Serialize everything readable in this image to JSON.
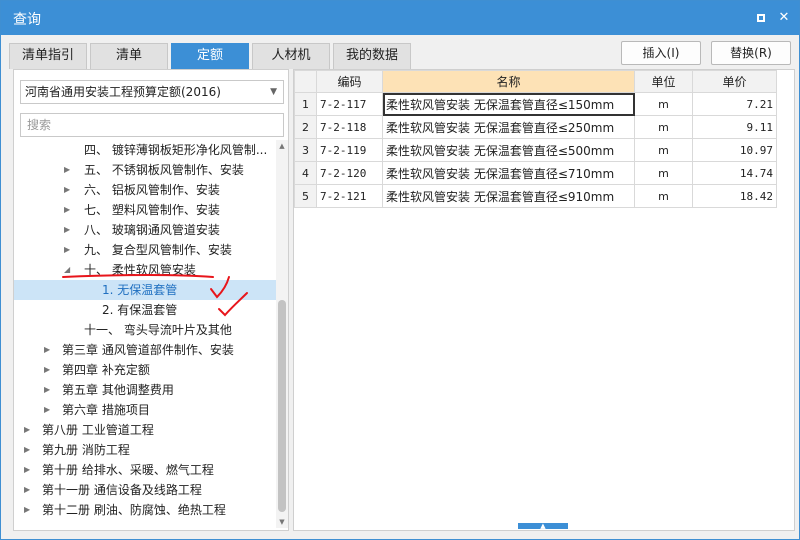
{
  "window": {
    "title": "查询"
  },
  "tabs": [
    {
      "label": "清单指引",
      "active": false
    },
    {
      "label": "清单",
      "active": false
    },
    {
      "label": "定额",
      "active": true
    },
    {
      "label": "人材机",
      "active": false
    },
    {
      "label": "我的数据",
      "active": false
    }
  ],
  "actions": {
    "insert_label": "插入(I)",
    "replace_label": "替换(R)"
  },
  "library": {
    "selected": "河南省通用安装工程预算定额(2016)"
  },
  "search": {
    "placeholder": "搜索"
  },
  "tree": [
    {
      "label": "四、 镀锌薄钢板矩形净化风管制...",
      "level": 3,
      "expanded": null,
      "selected": false
    },
    {
      "label": "五、 不锈钢板风管制作、安装",
      "level": 3,
      "expanded": false,
      "selected": false
    },
    {
      "label": "六、 铝板风管制作、安装",
      "level": 3,
      "expanded": false,
      "selected": false
    },
    {
      "label": "七、 塑料风管制作、安装",
      "level": 3,
      "expanded": false,
      "selected": false
    },
    {
      "label": "八、 玻璃钢通风管道安装",
      "level": 3,
      "expanded": false,
      "selected": false
    },
    {
      "label": "九、 复合型风管制作、安装",
      "level": 3,
      "expanded": false,
      "selected": false
    },
    {
      "label": "十、 柔性软风管安装",
      "level": 3,
      "expanded": true,
      "selected": false
    },
    {
      "label": "1. 无保温套管",
      "level": 4,
      "expanded": null,
      "selected": true
    },
    {
      "label": "2. 有保温套管",
      "level": 4,
      "expanded": null,
      "selected": false
    },
    {
      "label": "十一、 弯头导流叶片及其他",
      "level": 3,
      "expanded": null,
      "selected": false
    },
    {
      "label": "第三章 通风管道部件制作、安装",
      "level": 2,
      "expanded": false,
      "selected": false
    },
    {
      "label": "第四章 补充定额",
      "level": 2,
      "expanded": false,
      "selected": false
    },
    {
      "label": "第五章 其他调整费用",
      "level": 2,
      "expanded": false,
      "selected": false
    },
    {
      "label": "第六章 措施项目",
      "level": 2,
      "expanded": false,
      "selected": false
    },
    {
      "label": "第八册 工业管道工程",
      "level": 1,
      "expanded": false,
      "selected": false
    },
    {
      "label": "第九册 消防工程",
      "level": 1,
      "expanded": false,
      "selected": false
    },
    {
      "label": "第十册 给排水、采暖、燃气工程",
      "level": 1,
      "expanded": false,
      "selected": false
    },
    {
      "label": "第十一册 通信设备及线路工程",
      "level": 1,
      "expanded": false,
      "selected": false
    },
    {
      "label": "第十二册 刷油、防腐蚀、绝热工程",
      "level": 1,
      "expanded": false,
      "selected": false
    }
  ],
  "grid": {
    "headers": {
      "code": "编码",
      "name": "名称",
      "unit": "单位",
      "price": "单价"
    },
    "rows": [
      {
        "n": "1",
        "code": "7-2-117",
        "name": "柔性软风管安装 无保温套管直径≤150mm",
        "unit": "m",
        "price": "7.21"
      },
      {
        "n": "2",
        "code": "7-2-118",
        "name": "柔性软风管安装 无保温套管直径≤250mm",
        "unit": "m",
        "price": "9.11"
      },
      {
        "n": "3",
        "code": "7-2-119",
        "name": "柔性软风管安装 无保温套管直径≤500mm",
        "unit": "m",
        "price": "10.97"
      },
      {
        "n": "4",
        "code": "7-2-120",
        "name": "柔性软风管安装 无保温套管直径≤710mm",
        "unit": "m",
        "price": "14.74"
      },
      {
        "n": "5",
        "code": "7-2-121",
        "name": "柔性软风管安装 无保温套管直径≤910mm",
        "unit": "m",
        "price": "18.42"
      }
    ]
  },
  "colors": {
    "accent": "#3c8fd6",
    "selected_row": "#cce4f7",
    "name_header": "#fde2b6",
    "annotation": "#e8151b"
  }
}
